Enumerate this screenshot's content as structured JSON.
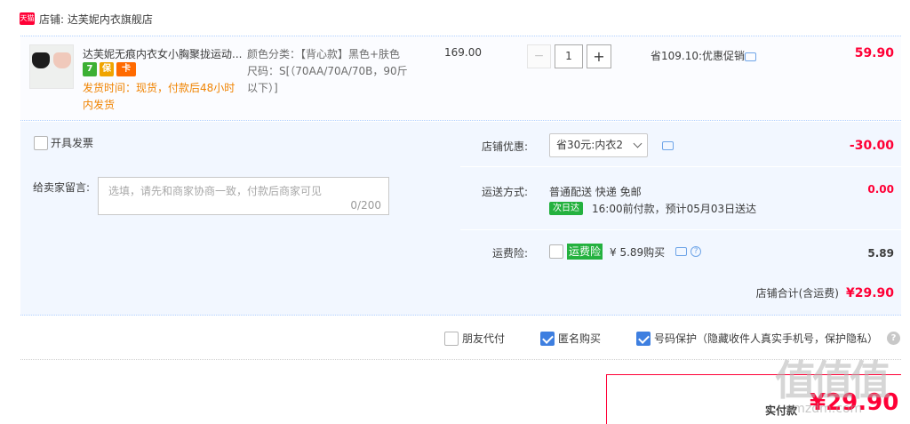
{
  "shop": {
    "badge": "天猫",
    "title": "店铺: 达芙妮内衣旗舰店"
  },
  "item": {
    "title": "达芙妮无痕内衣女小胸聚拢运动...",
    "badge_icons": [
      "7",
      "保",
      "卡"
    ],
    "ship_note": "发货时间：现货，付款后48小时内发货",
    "sku_color": "颜色分类：【背心款】黑色+肤色",
    "sku_size": "尺码：S[（70AA/70A/70B，90斤以下）]",
    "unit_price": "169.00",
    "qty_minus": "−",
    "quantity": "1",
    "qty_plus": "+",
    "promo": "省109.10:优惠促销",
    "line_total": "59.90"
  },
  "options": {
    "invoice_label": "开具发票",
    "message_label": "给卖家留言:",
    "message_placeholder": "选填，请先和商家协商一致，付款后商家可见",
    "message_count": "0/200",
    "coupon_label": "店铺优惠:",
    "coupon_value": "省30元:内衣2",
    "coupon_amount": "-30.00",
    "shipping_label": "运送方式:",
    "shipping_value": "普通配送 快递 免邮",
    "next_day_tag": "次日达",
    "delivery_note": "16:00前付款，预计05月03日送达",
    "shipping_amount": "0.00",
    "insurance_label": "运费险:",
    "insurance_tag": "运费险",
    "insurance_price": "¥ 5.89购买",
    "insurance_amount": "5.89"
  },
  "shop_total": {
    "label": "店铺合计(含运费)",
    "amount": "¥29.90"
  },
  "checkout_options": {
    "friend_pay": "朋友代付",
    "anonymous": "匿名购买",
    "number_protect": "号码保护（隐藏收件人真实手机号，保护隐私）",
    "help": "?"
  },
  "payment": {
    "label": "实付款",
    "amount": "¥29.90"
  },
  "watermark": {
    "text": "值值值",
    "url": "smzdm.com"
  },
  "colors": {
    "accent_red": "#ff0036",
    "light_blue_bg": "#f2f7ff",
    "orange_note": "#f08300",
    "green_tag": "#24b13f",
    "checkbox_blue": "#3e7fe0"
  }
}
